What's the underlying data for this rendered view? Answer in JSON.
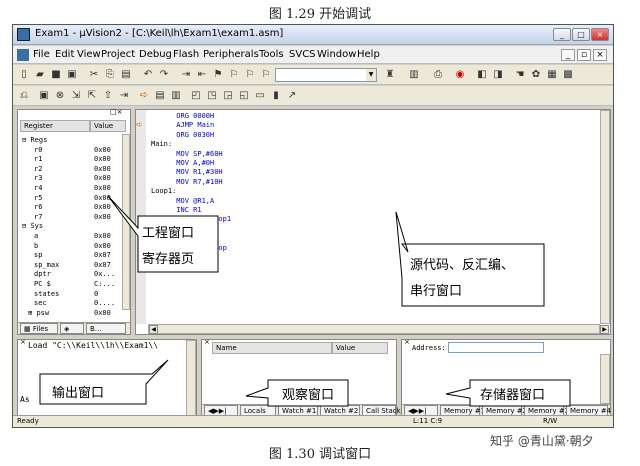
{
  "captions": {
    "top": "图 1.29 开始调试",
    "bottom": "图 1.30 调试窗口"
  },
  "window": {
    "title": "Exam1 - μVision2 - [C:\\Keil\\lh\\Exam1\\exam1.asm]"
  },
  "menu": [
    "File",
    "Edit",
    "View",
    "Project",
    "Debug",
    "Flash",
    "Peripherals",
    "Tools",
    "SVCS",
    "Window",
    "Help"
  ],
  "registers": {
    "col_register": "Register",
    "col_value": "Value",
    "rows": [
      {
        "name": "Regs",
        "value": "",
        "indent": 0,
        "expander": "⊟"
      },
      {
        "name": "r0",
        "value": "0x00",
        "indent": 2
      },
      {
        "name": "r1",
        "value": "0x00",
        "indent": 2
      },
      {
        "name": "r2",
        "value": "0x00",
        "indent": 2
      },
      {
        "name": "r3",
        "value": "0x00",
        "indent": 2
      },
      {
        "name": "r4",
        "value": "0x00",
        "indent": 2
      },
      {
        "name": "r5",
        "value": "0x00",
        "indent": 2
      },
      {
        "name": "r6",
        "value": "0x00",
        "indent": 2
      },
      {
        "name": "r7",
        "value": "0x00",
        "indent": 2
      },
      {
        "name": "Sys",
        "value": "",
        "indent": 0,
        "expander": "⊟"
      },
      {
        "name": "a",
        "value": "0x00",
        "indent": 2
      },
      {
        "name": "b",
        "value": "0x00",
        "indent": 2
      },
      {
        "name": "sp",
        "value": "0x07",
        "indent": 2
      },
      {
        "name": "sp_max",
        "value": "0x07",
        "indent": 2
      },
      {
        "name": "dptr",
        "value": "0x...",
        "indent": 2
      },
      {
        "name": "PC  $",
        "value": "C:...",
        "indent": 2
      },
      {
        "name": "states",
        "value": "0",
        "indent": 2
      },
      {
        "name": "sec",
        "value": "0....",
        "indent": 2
      },
      {
        "name": "psw",
        "value": "0x00",
        "indent": 1,
        "expander": "⊞"
      }
    ],
    "tabs": [
      "Files",
      "B..."
    ]
  },
  "code_lines": [
    "      ORG 0000H",
    "      AJMP Main",
    "      ORG 0030H",
    "Main:",
    "      MOV SP,#60H",
    "      MOV A,#0H",
    "      MOV R1,#30H",
    "      MOV R7,#10H",
    "Loop1:",
    "      MOV @R1,A",
    "      INC R1",
    "      DJNZ R7,Loop1",
    "",
    "",
    "",
    "      INC R1",
    "      INC A",
    "      DJNZ R7,Loop",
    "",
    "      SJMP $"
  ],
  "output": {
    "text": "Load \"C:\\\\Keil\\\\lh\\\\Exam1\\\\",
    "prefix": "As"
  },
  "watch": {
    "col_name": "Name",
    "col_value": "Value",
    "tabs": [
      "Locals",
      "Watch #1",
      "Watch #2",
      "Call Stack"
    ]
  },
  "memory": {
    "label": "Address:",
    "tabs": [
      "Memory #1",
      "Memory #2",
      "Memory #3",
      "Memory #4"
    ]
  },
  "status": {
    "left": "Ready",
    "pos": "L:11 C:9",
    "mode": "R/W"
  },
  "callouts": {
    "project": [
      "工程窗口",
      "寄存器页"
    ],
    "source": [
      "源代码、反汇编、",
      "串行窗口"
    ],
    "output": "输出窗口",
    "watch": "观察窗口",
    "memory": "存储器窗口"
  },
  "watermark": "知乎 @青山黛·朝夕"
}
